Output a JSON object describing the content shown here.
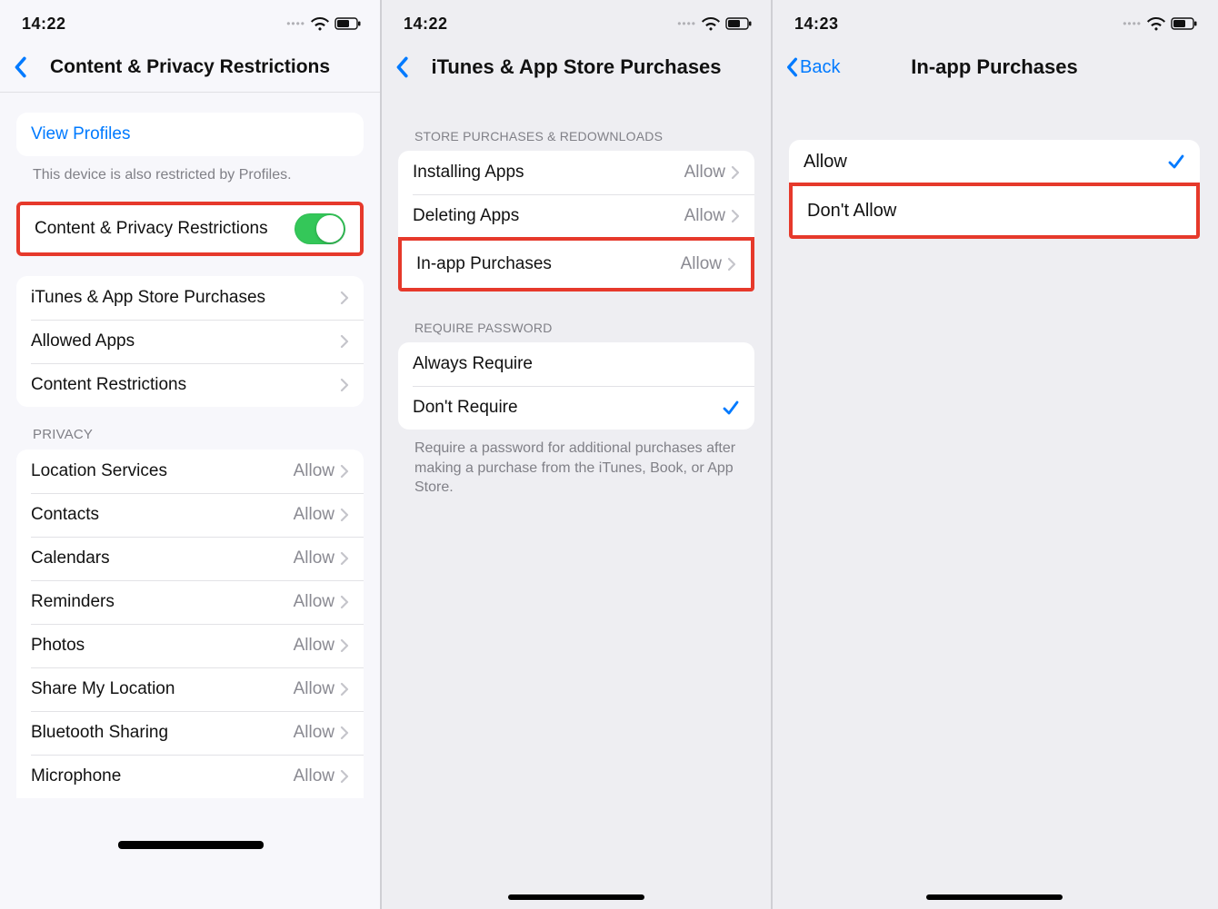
{
  "screens": {
    "s1": {
      "time": "14:22",
      "title": "Content & Privacy Restrictions",
      "view_profiles": "View Profiles",
      "profile_note": "This device is also restricted by Profiles.",
      "toggle_row": {
        "label": "Content & Privacy Restrictions",
        "on": true
      },
      "nav_items": [
        {
          "label": "iTunes & App Store Purchases"
        },
        {
          "label": "Allowed Apps"
        },
        {
          "label": "Content Restrictions"
        }
      ],
      "privacy_header": "PRIVACY",
      "privacy_items": [
        {
          "label": "Location Services",
          "value": "Allow"
        },
        {
          "label": "Contacts",
          "value": "Allow"
        },
        {
          "label": "Calendars",
          "value": "Allow"
        },
        {
          "label": "Reminders",
          "value": "Allow"
        },
        {
          "label": "Photos",
          "value": "Allow"
        },
        {
          "label": "Share My Location",
          "value": "Allow"
        },
        {
          "label": "Bluetooth Sharing",
          "value": "Allow"
        },
        {
          "label": "Microphone",
          "value": "Allow"
        }
      ]
    },
    "s2": {
      "time": "14:22",
      "title": "iTunes & App Store Purchases",
      "store_header": "STORE PURCHASES & REDOWNLOADS",
      "store_items": [
        {
          "label": "Installing Apps",
          "value": "Allow"
        },
        {
          "label": "Deleting Apps",
          "value": "Allow"
        },
        {
          "label": "In-app Purchases",
          "value": "Allow",
          "highlight": true
        }
      ],
      "password_header": "REQUIRE PASSWORD",
      "password_items": [
        {
          "label": "Always Require",
          "checked": false
        },
        {
          "label": "Don't Require",
          "checked": true
        }
      ],
      "password_note": "Require a password for additional purchases after making a purchase from the iTunes, Book, or App Store."
    },
    "s3": {
      "time": "14:23",
      "back_label": "Back",
      "title": "In-app Purchases",
      "options": [
        {
          "label": "Allow",
          "checked": true
        },
        {
          "label": "Don't Allow",
          "checked": false,
          "highlight": true
        }
      ]
    }
  }
}
